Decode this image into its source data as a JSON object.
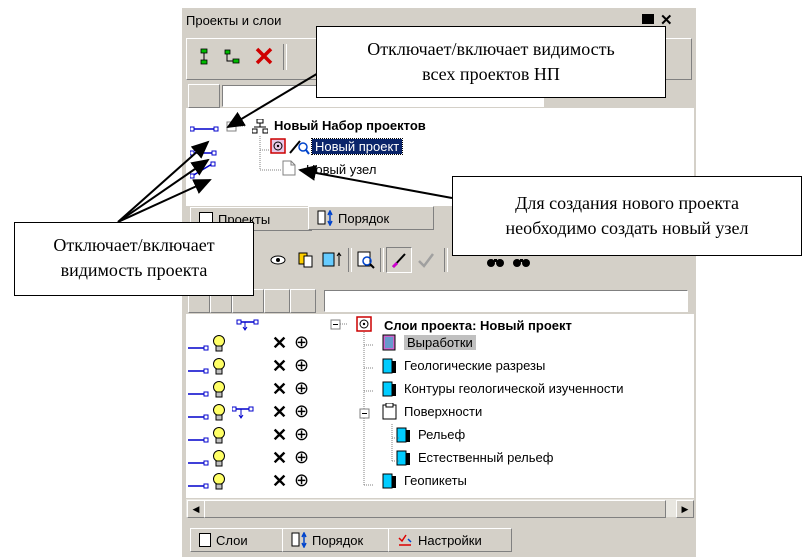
{
  "window": {
    "title": "Проекты и слои"
  },
  "top_toolbar": {
    "buttons": [
      "add-project-icon",
      "add-node-icon",
      "delete-icon"
    ]
  },
  "project_tree": {
    "root_label": "Новый Набор проектов",
    "project_label": "Новый проект",
    "node_label": "Новый узел"
  },
  "top_tabs": {
    "projects": "Проекты",
    "order": "Порядок"
  },
  "layer_tree": {
    "root_label": "Слои проекта: Новый проект",
    "layers": [
      {
        "label": "Выработки",
        "level": 1
      },
      {
        "label": "Геологические разрезы",
        "level": 1
      },
      {
        "label": "Контуры геологической изученности",
        "level": 1
      },
      {
        "label": "Поверхности",
        "level": 1
      },
      {
        "label": "Рельеф",
        "level": 2
      },
      {
        "label": "Естественный рельеф",
        "level": 2
      },
      {
        "label": "Геопикеты",
        "level": 1
      }
    ]
  },
  "bottom_tabs": {
    "layers": "Слои",
    "order": "Порядок",
    "settings": "Настройки"
  },
  "callouts": {
    "all_projects_visibility": [
      "Отключает/включает видимость",
      "всех проектов НП"
    ],
    "new_project": [
      "Для создания нового проекта",
      "необходимо создать новый узел"
    ],
    "project_visibility": [
      "Отключает/включает",
      "видимость проекта"
    ]
  },
  "colors": {
    "selection": "#0a246a",
    "panel": "#d4d0c8",
    "lamp": "#ffff66"
  }
}
